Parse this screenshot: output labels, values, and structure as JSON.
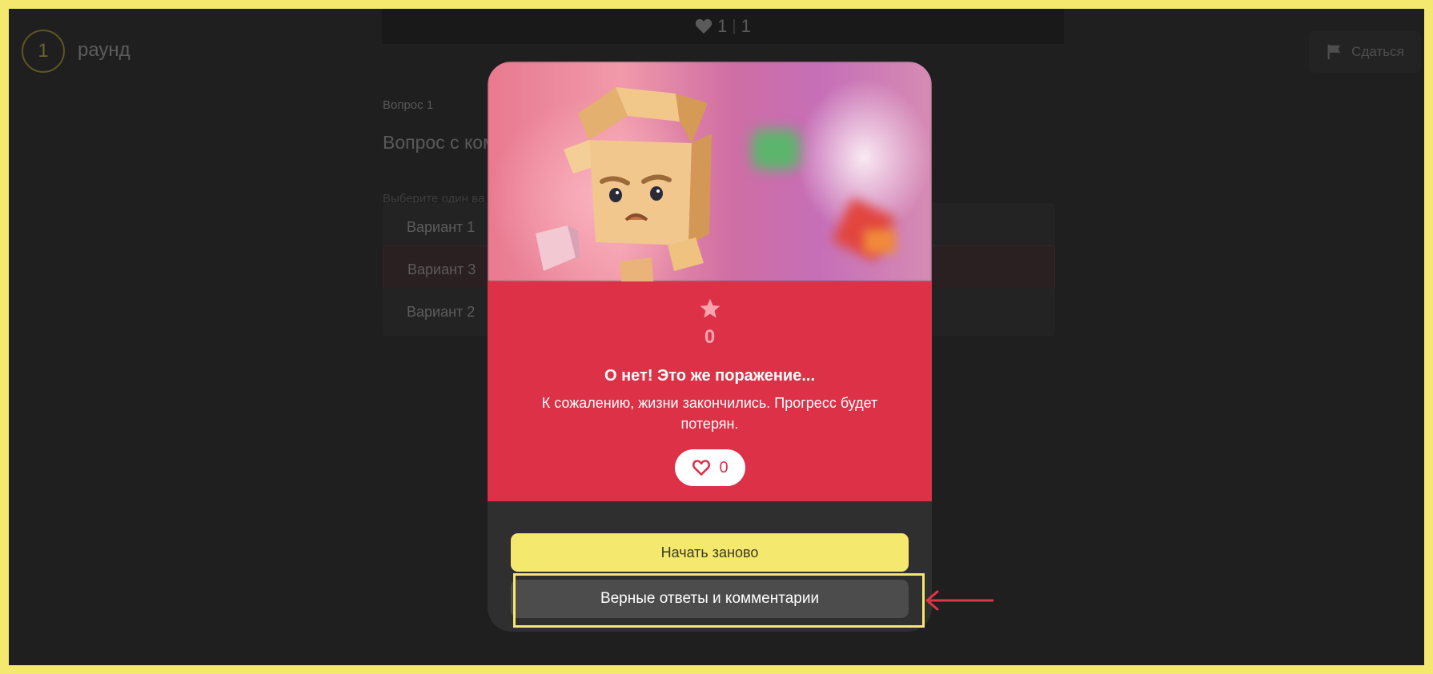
{
  "header": {
    "round_number": "1",
    "round_label": "раунд",
    "lives_current": "1",
    "lives_total": "1",
    "surrender_label": "Сдаться"
  },
  "question": {
    "number_label": "Вопрос 1",
    "title": "Вопрос с комм",
    "hint": "Выберите один ва",
    "options": [
      {
        "label": "Вариант 1"
      },
      {
        "label": "Вариант 3"
      },
      {
        "label": "Вариант 2"
      }
    ]
  },
  "modal": {
    "score": "0",
    "title": "О нет! Это же поражение...",
    "text": "К сожалению, жизни закончились. Прогресс будет потерян.",
    "lives_left": "0",
    "restart_label": "Начать заново",
    "answers_label": "Верные ответы и комментарии"
  },
  "colors": {
    "accent_yellow": "#f4e86e",
    "defeat_red": "#dc3147",
    "annotation_arrow": "#e0344a"
  }
}
